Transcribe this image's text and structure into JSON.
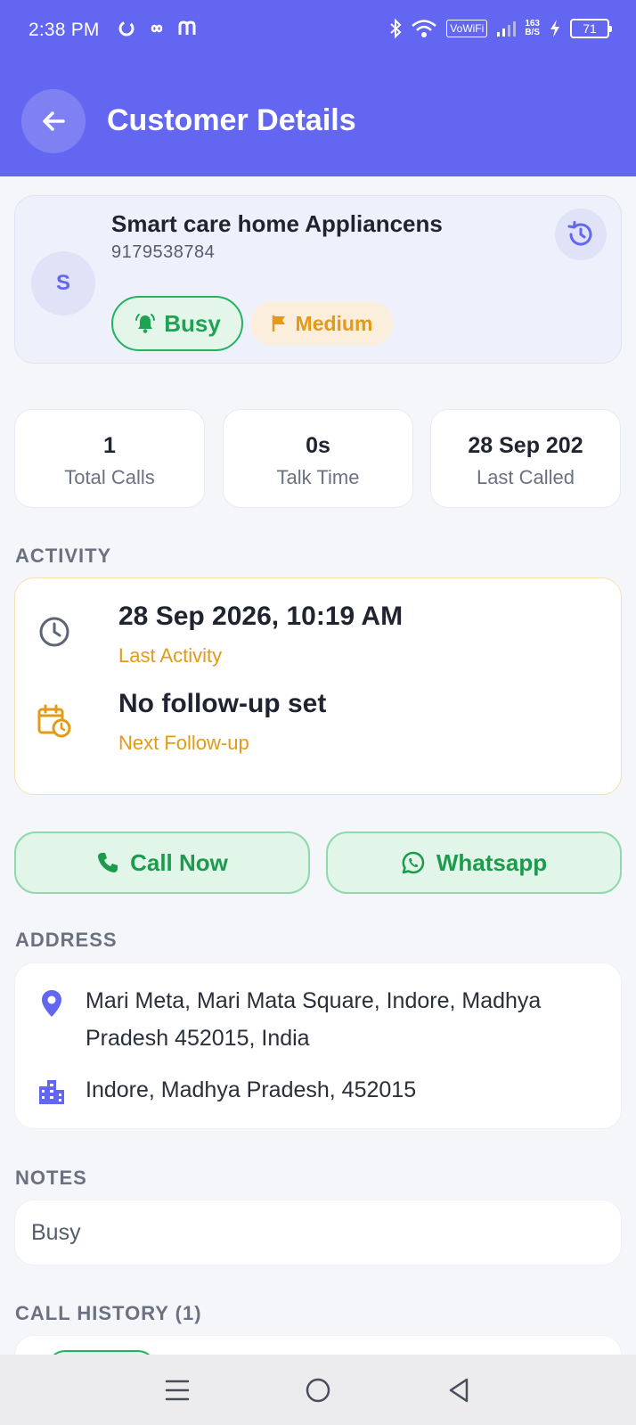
{
  "status_bar": {
    "time": "2:38 PM",
    "vowifi": "VoWiFi",
    "speed_value": "163",
    "speed_unit": "B/S",
    "battery": "71"
  },
  "app_bar": {
    "title": "Customer Details",
    "back_icon": "arrow-left-icon"
  },
  "customer": {
    "avatar_initial": "S",
    "name": "Smart care home Appliancens",
    "phone": "9179538784",
    "status_label": "Busy",
    "priority_label": "Medium",
    "history_icon": "history-icon"
  },
  "stats": [
    {
      "value": "1",
      "label": "Total Calls"
    },
    {
      "value": "0s",
      "label": "Talk Time"
    },
    {
      "value": "28 Sep 202",
      "label": "Last Called"
    }
  ],
  "activity": {
    "section_title": "ACTIVITY",
    "last_activity_value": "28 Sep 2026, 10:19 AM",
    "last_activity_label": "Last Activity",
    "follow_up_value": "No follow-up set",
    "follow_up_label": "Next Follow-up"
  },
  "actions": {
    "call_label": "Call Now",
    "whatsapp_label": "Whatsapp"
  },
  "address": {
    "section_title": "ADDRESS",
    "full_address_line1": "Mari Meta, Mari Mata Square, Indore, Madhya",
    "full_address_line2": "Pradesh 452015, India",
    "city_line": "Indore, Madhya Pradesh, 452015"
  },
  "notes": {
    "section_title": "NOTES",
    "text": "Busy"
  },
  "call_history": {
    "section_title": "CALL HISTORY (1)"
  },
  "colors": {
    "primary": "#6366f1",
    "success": "#22b35e",
    "warning": "#e39a14",
    "background": "#f5f6fa"
  }
}
